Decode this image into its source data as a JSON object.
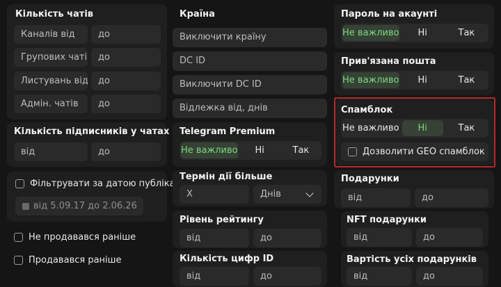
{
  "col1": {
    "chat_count": {
      "title": "Кількість чатів",
      "rows": [
        {
          "from": "Каналів від",
          "to": "до"
        },
        {
          "from": "Групових чатів",
          "to": "до"
        },
        {
          "from": "Листувань від",
          "to": "до"
        },
        {
          "from": "Адмін. чатів",
          "to": "до"
        }
      ]
    },
    "subscribers": {
      "title": "Кількість підписників у чатах",
      "from": "від",
      "to": "до"
    },
    "publication_filter": {
      "label": "Фільтрувати за датою публікації",
      "date_range": "від 5.09.17 до 2.06.26"
    },
    "not_sold_before": "Не продавався раніше",
    "sold_before": "Продавався раніше"
  },
  "col2": {
    "country": {
      "title": "Країна",
      "exclude_country": "Виключити країну",
      "dc_id": "DC ID",
      "exclude_dc_id": "Виключити DC ID",
      "lag_days": "Відлежка від, днів"
    },
    "premium": {
      "title": "Telegram Premium",
      "options": [
        "Не важливо",
        "Ні",
        "Так"
      ],
      "selected": 0
    },
    "term": {
      "title": "Термін дії більше",
      "value": "X",
      "unit": "Днів"
    },
    "rating": {
      "title": "Рівень рейтингу",
      "from": "від",
      "to": "до"
    },
    "digits": {
      "title": "Кількість цифр ID",
      "from": "від",
      "to": "до"
    }
  },
  "col3": {
    "password": {
      "title": "Пароль на акаунті",
      "options": [
        "Не важливо",
        "Ні",
        "Так"
      ],
      "selected": 0
    },
    "email": {
      "title": "Прив'язана пошта",
      "options": [
        "Не важливо",
        "Ні",
        "Так"
      ],
      "selected": 0
    },
    "spamblock": {
      "title": "Спамблок",
      "options": [
        "Не важливо",
        "Ні",
        "Так"
      ],
      "selected": 1,
      "allow_geo": "Дозволити GEO спамблок"
    },
    "gifts": {
      "title": "Подарунки",
      "from": "від",
      "to": "до"
    },
    "nft_gifts": {
      "title": "NFT подарунки",
      "from": "від",
      "to": "до"
    },
    "gifts_value": {
      "title": "Вартість усіх подарунків",
      "from": "від",
      "to": "до"
    }
  },
  "colors": {
    "active_green": "#7fd67f",
    "active_bg": "#354235",
    "highlight_red": "#b52a2a"
  }
}
